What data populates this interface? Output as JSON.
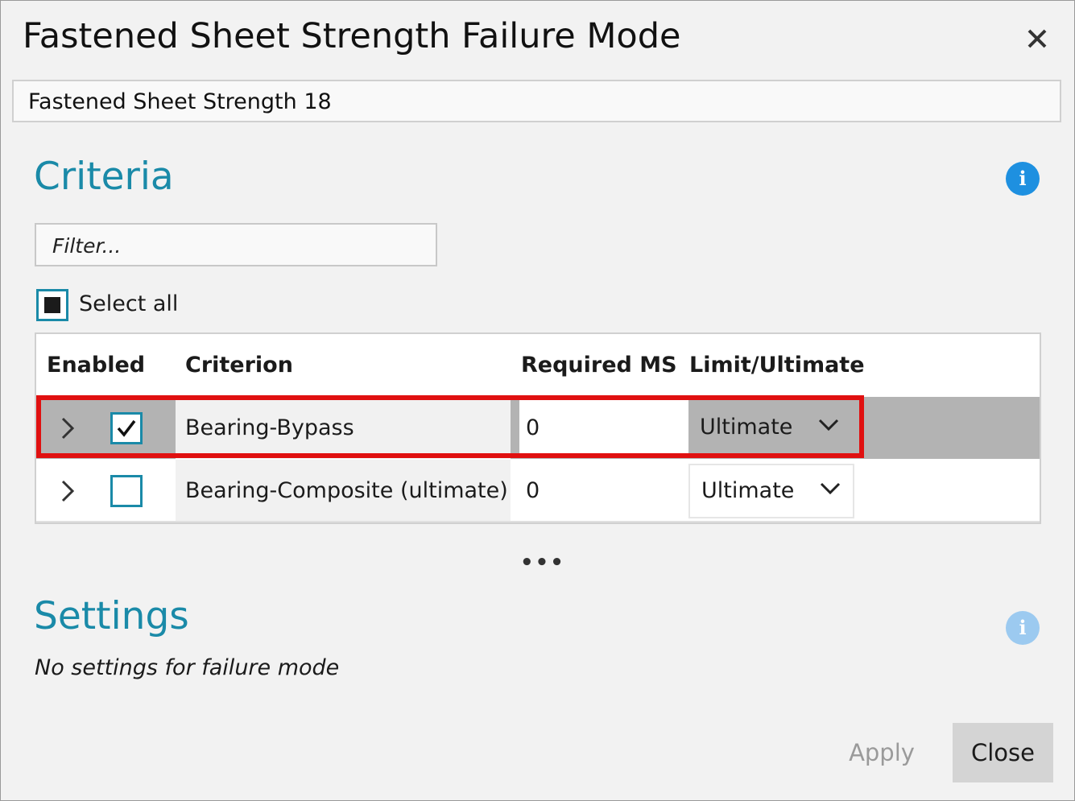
{
  "dialog": {
    "title": "Fastened Sheet Strength Failure Mode",
    "name_value": "Fastened Sheet Strength 18"
  },
  "criteria": {
    "heading": "Criteria",
    "filter_placeholder": "Filter...",
    "select_all_label": "Select all",
    "select_all_state": "indeterminate",
    "columns": [
      "Enabled",
      "Criterion",
      "Required MS",
      "Limit/Ultimate"
    ],
    "rows": [
      {
        "enabled": true,
        "criterion": "Bearing-Bypass",
        "required_ms": "0",
        "limit_ultimate": "Ultimate",
        "selected": true
      },
      {
        "enabled": false,
        "criterion": "Bearing-Composite (ultimate)",
        "required_ms": "0",
        "limit_ultimate": "Ultimate",
        "selected": false
      }
    ],
    "more_indicator": "•••"
  },
  "settings": {
    "heading": "Settings",
    "note": "No settings for failure mode"
  },
  "buttons": {
    "apply": "Apply",
    "close": "Close"
  },
  "colors": {
    "accent": "#1a8aa8",
    "highlight": "#e01010",
    "info": "#1e90e0",
    "selected_row": "#b3b3b3"
  },
  "icons": [
    "close-icon",
    "info-icon",
    "chevron-right-icon",
    "checkmark-icon",
    "chevron-down-icon"
  ]
}
